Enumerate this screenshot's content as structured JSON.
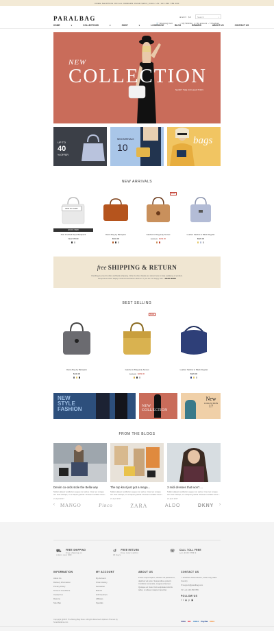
{
  "topbar": {
    "text": "FREE SHIPPING ON ALL ORDERS OVER $150  |  CALL US: 123 456 789 000"
  },
  "header": {
    "logo": "PARALBAG",
    "lang": "EN",
    "currency": "$",
    "search_placeholder": "Search",
    "account": [
      "Shopping Cart",
      "My Wishlist",
      "My account",
      "Checkout"
    ]
  },
  "nav": [
    "HOME",
    "COLLECTIONS",
    "SHOP",
    "LOOKBOOK",
    "BLOG",
    "BRANDS",
    "ABOUT US",
    "CONTACT US"
  ],
  "hero": {
    "line1": "NEW",
    "line2": "COLLECTION",
    "cta": "SHOP THE COLLECTION"
  },
  "promos": {
    "p1_up": "UP TO",
    "p1_pct": "40",
    "p1_off": "% OFFER",
    "p2_line": "NEW ARRIVALS",
    "p2_num": "10",
    "p3_word": "bags"
  },
  "new_arrivals": {
    "title": "NEW ARRIVALS",
    "add_to_cart": "ADD TO CART",
    "quick_view": "QUICK VIEW",
    "products": [
      {
        "name": "Alan Football Rope Backpack",
        "price": "Now $78.00"
      },
      {
        "name": "Dante Bag by Backpack",
        "price": "$342.00"
      },
      {
        "name": "Gatchel in Burgundy Sunset",
        "old": "$245.00",
        "price": "$199.00",
        "badge": "SALE"
      },
      {
        "name": "Leather Satchel in Black Regular",
        "price": "$320.00"
      }
    ]
  },
  "shipping": {
    "title_free": "free",
    "title_rest": "SHIPPING & RETURN",
    "text": "Paralbag is proud to offer worldwide shipping. Order & other details are shown here to help satisfying of product. Perspicious etiam aliquip nostrud exercitation ullamco. If you are not happy with...",
    "more": "READ MORE"
  },
  "best_selling": {
    "title": "BEST SELLING",
    "products": [
      {
        "name": "Dante Bag by Backpack",
        "price": "$140.00"
      },
      {
        "name": "Gatchel in Burgundy Sunset",
        "old": "$345.00",
        "price": "$299.00",
        "badge": "SALE"
      },
      {
        "name": "Leather Satchel in Black Regular",
        "price": "$320.00"
      }
    ]
  },
  "lookbook": {
    "b1_l1": "NEW",
    "b1_l2": "STYLE",
    "b1_l3": "FASHION",
    "b2": "NEW COLLECTION",
    "b3_l1": "New",
    "b3_l2": "COLLECTION",
    "b3_l3": "17"
  },
  "blogs": {
    "title": "FROM THE BLOGS",
    "posts": [
      {
        "title": "Denim co-ords stole the Bella way",
        "text": "Nullam aliquet vestibulum augue non varius. Cras nec congue elit. Duis tristique, ex a aliquet gravida. Praesent sodales lorem...",
        "date": "21 April 2017"
      },
      {
        "title": "The top knot just got a mega...",
        "text": "Nullam aliquet vestibulum augue non varius. Cras nec congue elit. Duis tristique, ex a aliquet gravida. Praesent sodales lorem...",
        "date": "21 April 2017"
      },
      {
        "title": "3 midi dresses that won't ...",
        "text": "Nullam aliquet vestibulum augue non varius. Cras nec congue elit. Duis tristique, ex a aliquet gravida. Praesent sodales lorem...",
        "date": "21 April 2017"
      }
    ]
  },
  "brands": [
    "MANGO",
    "Pinco",
    "ZARA",
    "ALDO",
    "DKNY"
  ],
  "footer": {
    "services": [
      {
        "title": "FREE SHIPPING",
        "sub": "Free shipping on orders over $99"
      },
      {
        "title": "FREE RETURN",
        "sub": "Free return within 30 days"
      },
      {
        "title": "CALL TOLL FREE",
        "sub": "(+1) 2345 6789 0"
      }
    ],
    "information": {
      "title": "INFORMATION",
      "items": [
        "About Us",
        "Delivery Information",
        "Privacy Policy",
        "Terms & Conditions",
        "Contact Us",
        "Returns",
        "Site Map"
      ]
    },
    "my_account": {
      "title": "MY ACCOUNT",
      "items": [
        "My Account",
        "Order History",
        "Newsletter",
        "Brands",
        "Gift Vouchers",
        "Affiliates",
        "Specials"
      ]
    },
    "about": {
      "title": "ABOUT US",
      "text": "Fusce turpis sapien, ultrices vel placerat et, dapibus vel justo. Suspendisse potenti. Curabitur venenatis, magna at laoreet. Quisque ac risus. Duis vulputate lobortis tellus, ut aliquet magna imperdiet."
    },
    "contact": {
      "title": "CONTACT US",
      "lines": [
        "123 Paris Street Name, Cubic City, Main Country",
        "support@paralbag.com",
        "(+1) 123 456 789"
      ]
    },
    "follow": "FOLLOW US",
    "copyright": "Copyright @2017 The Mixing Bag Store. All rights Reserved. Alpineon Themes by SmartAddons.com",
    "payments": [
      "VISA",
      "MC",
      "AMEX",
      "PayPal",
      "DISC"
    ]
  },
  "colors": {
    "hero": "#c96c5a",
    "accent": "#c0392b",
    "cream": "#f0e6d2"
  }
}
